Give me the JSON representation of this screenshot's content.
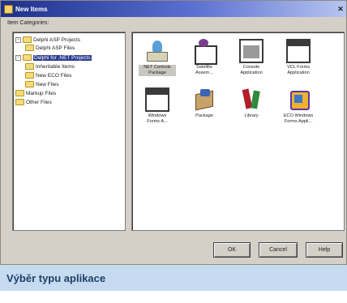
{
  "window": {
    "title": "New Items"
  },
  "categories_label": "Item Categories:",
  "tree": [
    {
      "label": "Delphi ASP Projects",
      "expander": "−"
    },
    {
      "label": "Delphi ASP Files",
      "expander": ""
    },
    {
      "label": "Delphi for .NET Projects",
      "expander": "−",
      "selected": true
    },
    {
      "label": "Inheritable Items",
      "expander": ""
    },
    {
      "label": "New ECO Files",
      "expander": ""
    },
    {
      "label": "New Files",
      "expander": ""
    },
    {
      "label": "Markup Files",
      "expander": ""
    },
    {
      "label": "Other Files",
      "expander": ""
    }
  ],
  "items": [
    {
      "label": "NET Controls\nPackage",
      "icon": "net-controls-package-icon",
      "selected": true
    },
    {
      "label": "Satellite\nAssem...",
      "icon": "satellite-assembly-icon"
    },
    {
      "label": "Console\nApplication",
      "icon": "console-application-icon"
    },
    {
      "label": "VCL Forms\nApplication",
      "icon": "vcl-forms-application-icon"
    },
    {
      "label": "Windows\nForms A...",
      "icon": "windows-forms-application-icon"
    },
    {
      "label": "Package",
      "icon": "package-icon"
    },
    {
      "label": "Library",
      "icon": "library-icon"
    },
    {
      "label": "ECO Windows\nForms Appli...",
      "icon": "eco-windows-forms-icon"
    }
  ],
  "buttons": {
    "ok": "OK",
    "cancel": "Cancel",
    "help": "Help"
  },
  "caption": "Výběr typu aplikace",
  "colors": {
    "titlebar": "#1c2f8a",
    "selection": "#2c3e8f",
    "dialog_bg": "#d4d0c8",
    "caption_bg": "#c6dbf0",
    "caption_text": "#1e3f66"
  }
}
